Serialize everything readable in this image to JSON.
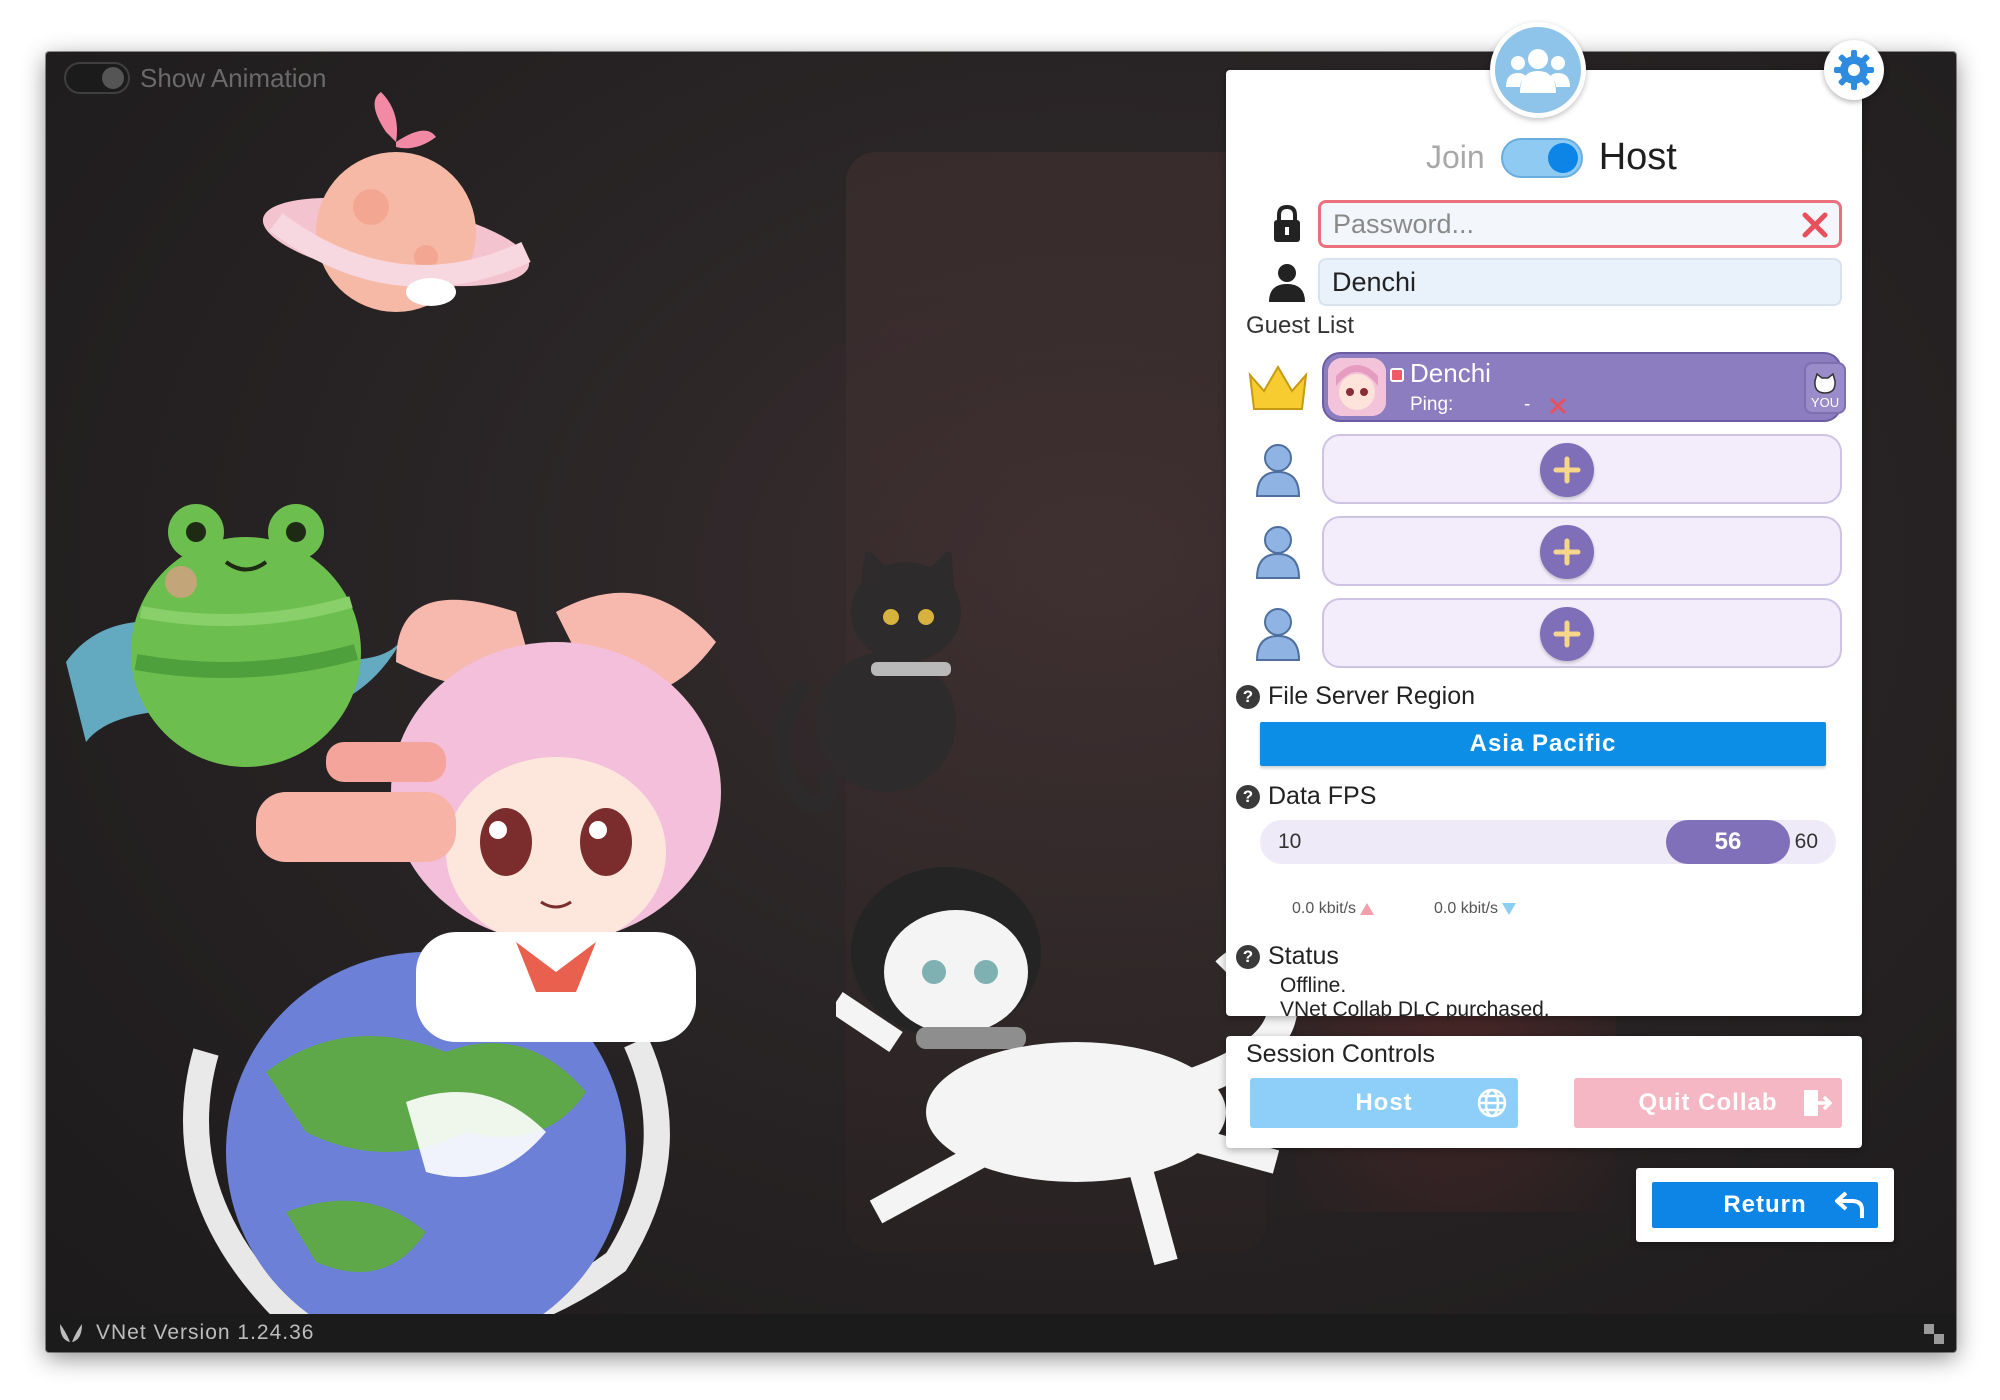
{
  "animation_toggle": {
    "label": "Show Animation",
    "on": false
  },
  "statusbar": {
    "version": "VNet Version  1.24.36"
  },
  "mode": {
    "join_label": "Join",
    "host_label": "Host",
    "selected": "Host"
  },
  "password": {
    "placeholder": "Password...",
    "value": ""
  },
  "username": {
    "value": "Denchi"
  },
  "guest_list": {
    "label": "Guest List",
    "host": {
      "name": "Denchi",
      "ping_label": "Ping:",
      "ping_value": "-",
      "you_label": "YOU"
    },
    "empty_slots": 3
  },
  "file_server": {
    "label": "File Server Region",
    "value": "Asia Pacific"
  },
  "data_fps": {
    "label": "Data FPS",
    "min": 10,
    "max": 60,
    "value": 56,
    "max_label": "60",
    "min_label": "10",
    "value_label": "56",
    "upload_rate": "0.0 kbit/s",
    "download_rate": "0.0 kbit/s"
  },
  "status": {
    "label": "Status",
    "line1": "Offline.",
    "line2": "VNet Collab DLC purchased."
  },
  "session_controls": {
    "title": "Session Controls",
    "host_label": "Host",
    "quit_label": "Quit Collab"
  },
  "return": {
    "label": "Return"
  },
  "colors": {
    "accent": "#0c85e6",
    "purple": "#8070ba",
    "host_btn": "#8dcff8",
    "quit_btn": "#f4b7c3",
    "error": "#ec6f7c"
  },
  "icons": {
    "group": "group-icon",
    "settings": "gear-icon",
    "lock": "lock-icon",
    "user": "user-icon",
    "crown": "crown-icon",
    "globe": "globe-icon",
    "exit": "exit-icon",
    "return": "return-arrow-icon",
    "help": "help-icon"
  }
}
